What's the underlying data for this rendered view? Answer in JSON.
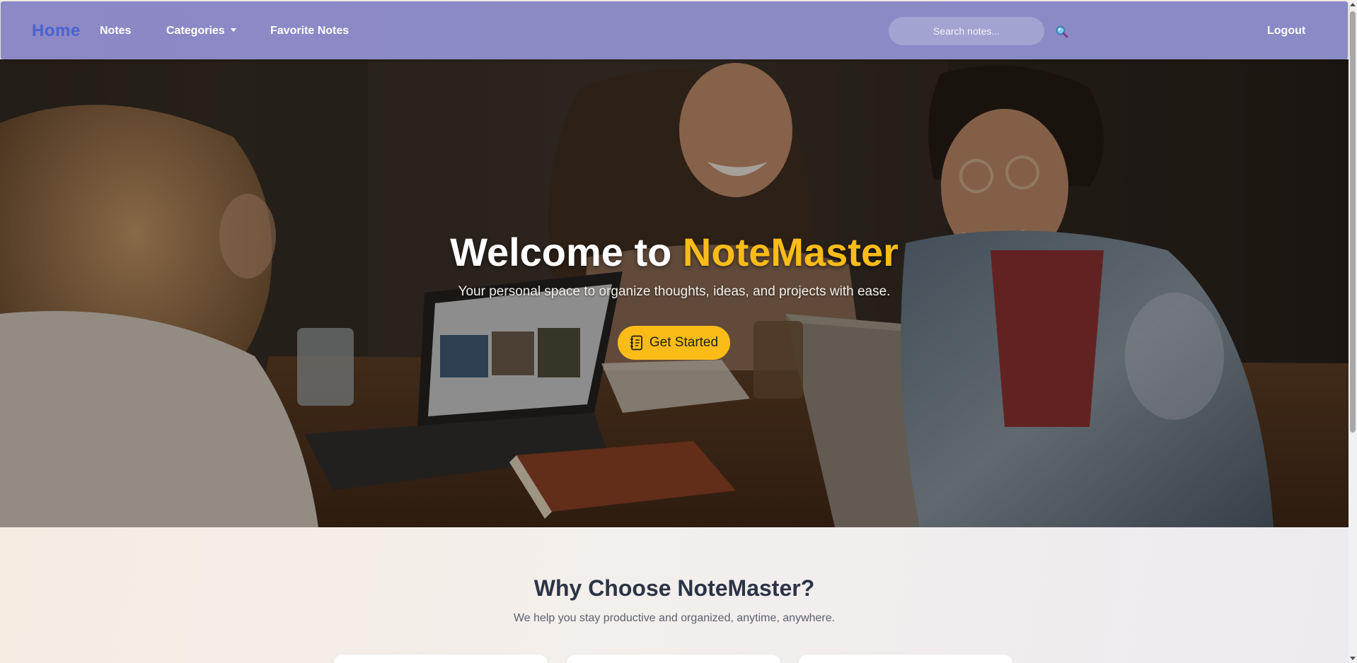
{
  "navbar": {
    "brand": "Home",
    "links": {
      "notes": "Notes",
      "categories": "Categories",
      "favorites": "Favorite Notes"
    },
    "search": {
      "placeholder": "Search notes...",
      "icon": "search-icon"
    },
    "logout": "Logout"
  },
  "hero": {
    "title_prefix": "Welcome to ",
    "title_brand": "NoteMaster",
    "subtitle": "Your personal space to organize thoughts, ideas, and projects with ease.",
    "cta_label": "Get Started",
    "cta_icon": "notebook-icon"
  },
  "features": {
    "title": "Why Choose NoteMaster?",
    "subtitle": "We help you stay productive and organized, anytime, anywhere."
  },
  "colors": {
    "navbar": "#8a8ac5",
    "brand": "#4a63cf",
    "accent": "#fbbc18",
    "heading": "#2c3446"
  }
}
